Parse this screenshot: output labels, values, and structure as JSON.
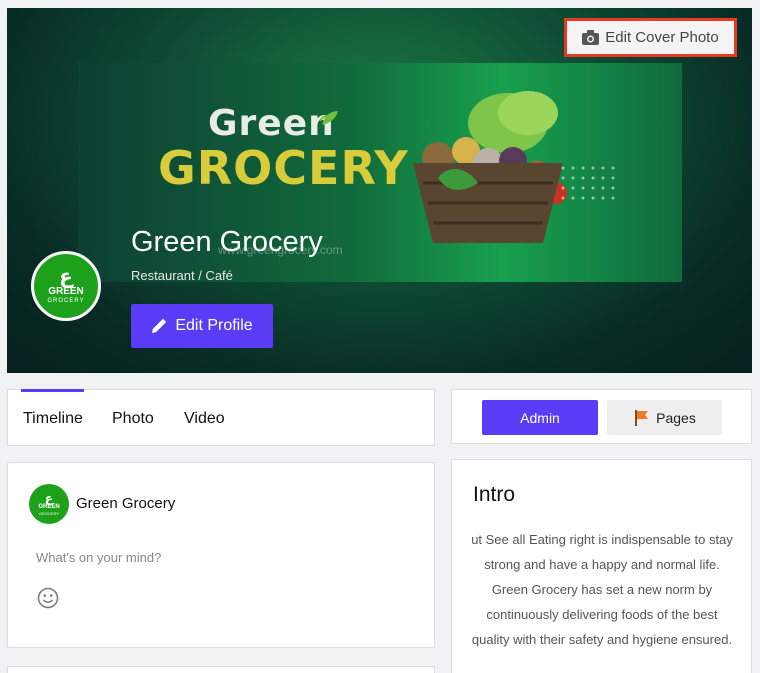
{
  "cover": {
    "edit_cover_label": "Edit Cover Photo",
    "banner": {
      "line1": "Green",
      "line2": "GROCERY",
      "url": "www.greengrocery.com"
    },
    "page_name": "Green Grocery",
    "category": "Restaurant / Café",
    "edit_profile_label": "Edit Profile",
    "avatar": {
      "glyph": "ع",
      "line1": "GREEN",
      "line2": "GROCERY"
    }
  },
  "tabs": [
    {
      "label": "Timeline",
      "active": true
    },
    {
      "label": "Photo",
      "active": false
    },
    {
      "label": "Video",
      "active": false
    }
  ],
  "roles": {
    "admin_label": "Admin",
    "pages_label": "Pages"
  },
  "composer": {
    "author": "Green Grocery",
    "placeholder": "What's on your mind?"
  },
  "intro": {
    "title": "Intro",
    "text": "ut See all Eating right is indispensable to stay strong and have a happy and normal life. Green Grocery has set a new norm by continuously delivering foods of the best quality with their safety and hygiene ensured."
  },
  "colors": {
    "accent": "#5b3cf6",
    "brand_green": "#1ea11a",
    "highlight_border": "#e83a22"
  }
}
